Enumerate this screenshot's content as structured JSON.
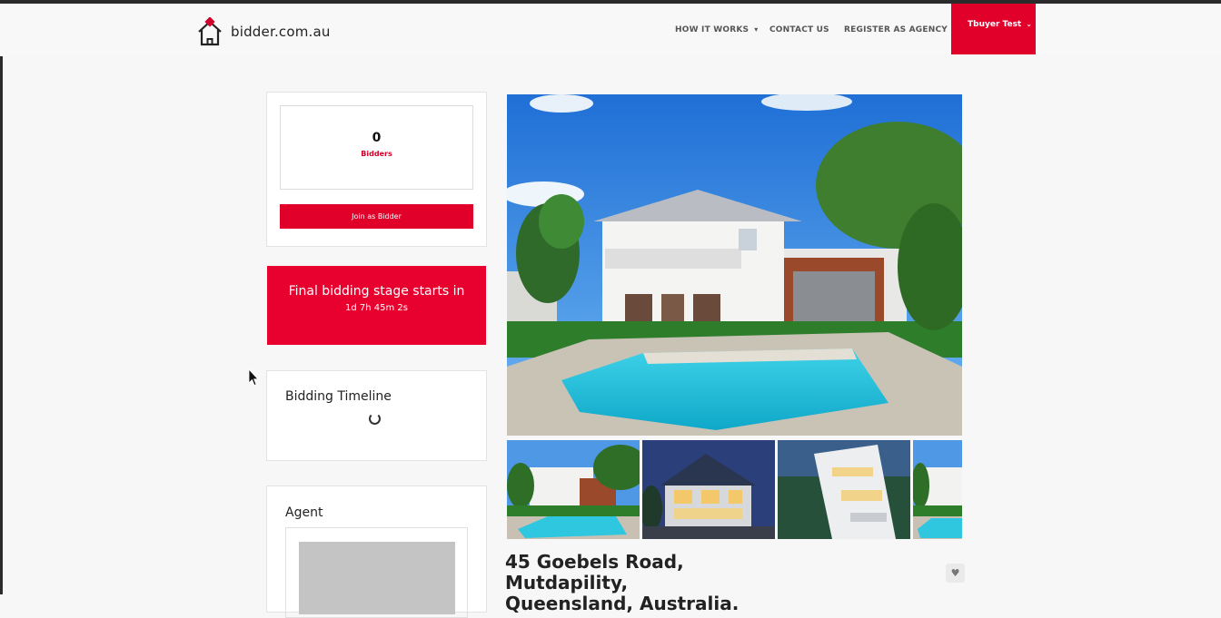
{
  "header": {
    "logo_text": "bidder.com.au",
    "nav": {
      "how_it_works": "HOW IT WORKS",
      "contact_us": "CONTACT US",
      "register_agency": "REGISTER AS AGENCY"
    },
    "user_menu_label": "Tbuyer Test"
  },
  "bidders": {
    "count": "0",
    "label": "Bidders",
    "join_button": "Join as Bidder"
  },
  "final_stage": {
    "title": "Final bidding stage starts in",
    "countdown": "1d 7h 45m 2s"
  },
  "timeline": {
    "heading": "Bidding Timeline"
  },
  "agent": {
    "heading": "Agent"
  },
  "property": {
    "address_line1": "45 Goebels Road, Mutdapility,",
    "address_line2": "Queensland, Australia."
  },
  "colors": {
    "accent": "#e0002a",
    "label_red": "#d0002a"
  },
  "icons": [
    "house-logo-icon",
    "chevron-down-icon",
    "heart-icon",
    "spinner-icon",
    "mouse-cursor-icon"
  ]
}
